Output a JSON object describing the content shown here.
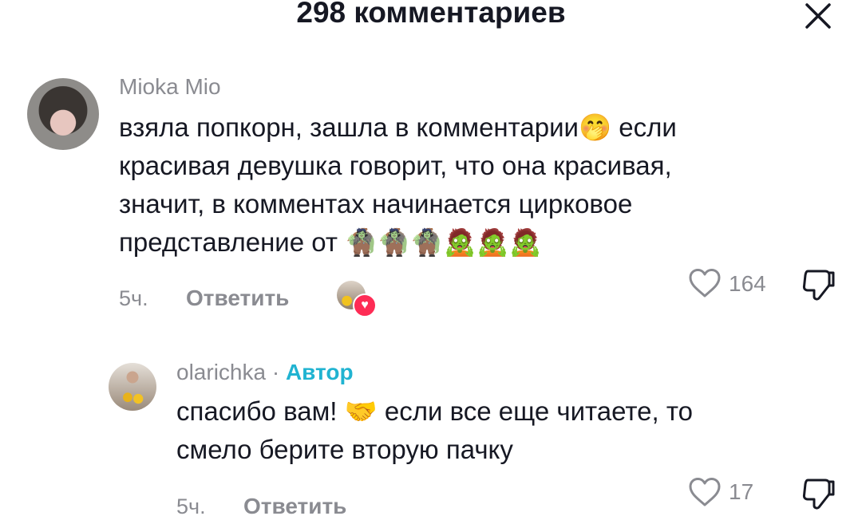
{
  "header": {
    "title": "298 комментариев"
  },
  "comments": [
    {
      "username": "Mioka Mio",
      "text": "взяла попкорн, зашла в комментарии🤭 если\nкрасивая девушка говорит, что она красивая,\nзначит, в комментах начинается цирковое\nпредставление от 🧌🧌🧌🧟🧟🧟",
      "time": "5ч.",
      "reply_label": "Ответить",
      "likes": "164",
      "liked_by_creator": true
    },
    {
      "username": "olarichka",
      "separator": "·",
      "author_badge": "Автор",
      "text": "спасибо вам! 🤝 если все еще читаете, то\nсмело берите вторую пачку",
      "time": "5ч.",
      "reply_label": "Ответить",
      "likes": "17"
    }
  ],
  "icons": {
    "close": "close-icon",
    "like": "heart-outline-icon",
    "dislike": "thumbs-down-icon",
    "creator_heart": "heart-filled-icon"
  },
  "colors": {
    "text": "#161823",
    "secondary": "#8a8b91",
    "author_badge": "#20b3d1",
    "heart": "#fe2c55"
  }
}
